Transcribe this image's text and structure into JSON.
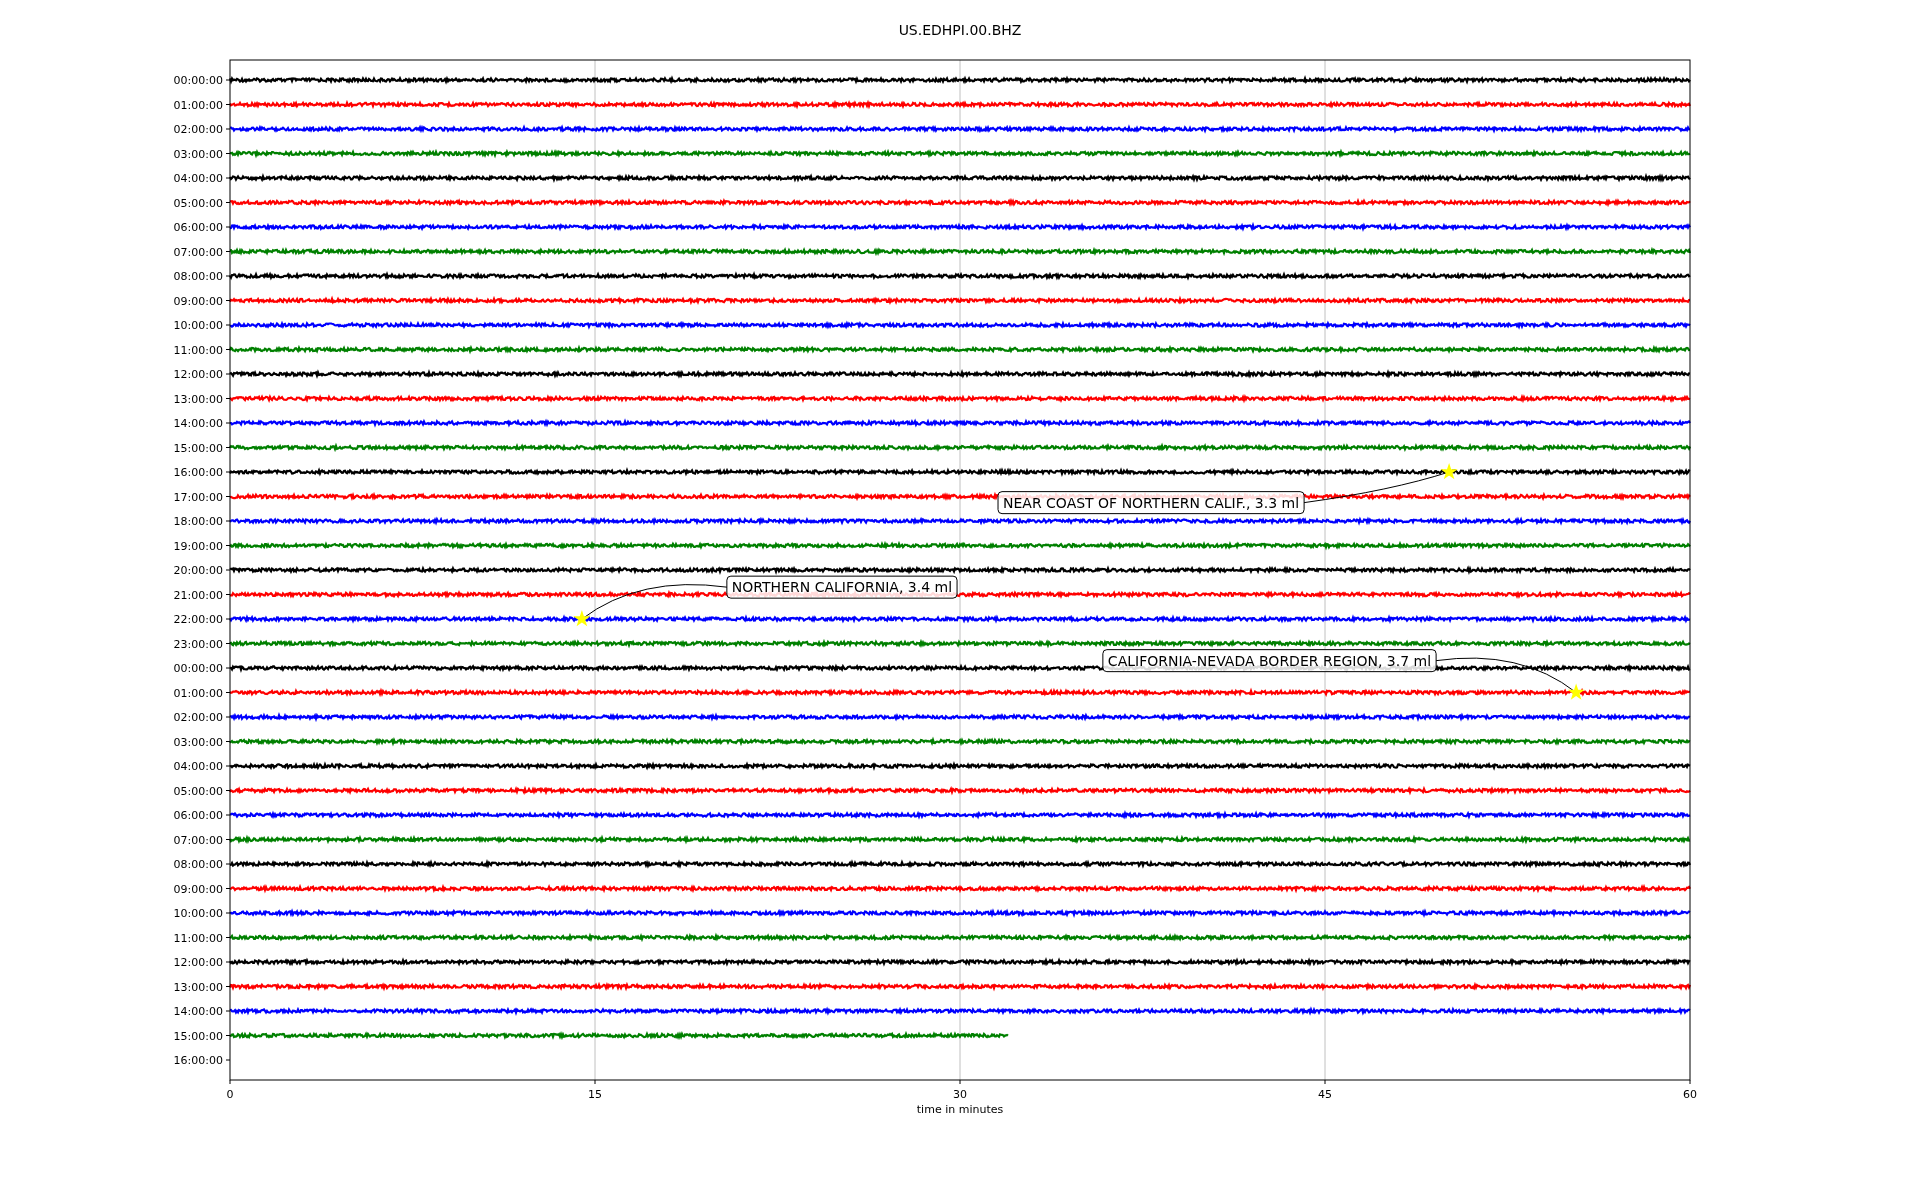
{
  "title": "US.EDHPI.00.BHZ",
  "helicorder": {
    "x_axis": {
      "label": "time in minutes",
      "ticks": [
        "0",
        "15",
        "30",
        "45",
        "60"
      ]
    },
    "rows": [
      {
        "label": "00:00:00",
        "color": "#000000",
        "level": 1
      },
      {
        "label": "01:00:00",
        "color": "#ff0000",
        "level": 1
      },
      {
        "label": "02:00:00",
        "color": "#0000ff",
        "level": 1
      },
      {
        "label": "03:00:00",
        "color": "#008000",
        "level": 1
      },
      {
        "label": "04:00:00",
        "color": "#000000",
        "level": 1
      },
      {
        "label": "05:00:00",
        "color": "#ff0000",
        "level": 1
      },
      {
        "label": "06:00:00",
        "color": "#0000ff",
        "level": 1
      },
      {
        "label": "07:00:00",
        "color": "#008000",
        "level": 1
      },
      {
        "label": "08:00:00",
        "color": "#000000",
        "level": 1
      },
      {
        "label": "09:00:00",
        "color": "#ff0000",
        "level": 1
      },
      {
        "label": "10:00:00",
        "color": "#0000ff",
        "level": 1
      },
      {
        "label": "11:00:00",
        "color": "#008000",
        "level": 1
      },
      {
        "label": "12:00:00",
        "color": "#000000",
        "level": 1
      },
      {
        "label": "13:00:00",
        "color": "#ff0000",
        "level": 1
      },
      {
        "label": "14:00:00",
        "color": "#0000ff",
        "level": 1
      },
      {
        "label": "15:00:00",
        "color": "#008000",
        "level": 1
      },
      {
        "label": "16:00:00",
        "color": "#000000",
        "level": 1,
        "events": [
          {
            "text": "NEAR COAST OF NORTHERN CALIF., 3.3 ml",
            "level": 0.835,
            "label_below": true
          }
        ]
      },
      {
        "label": "17:00:00",
        "color": "#ff0000",
        "level": 1
      },
      {
        "label": "18:00:00",
        "color": "#0000ff",
        "level": 1
      },
      {
        "label": "19:00:00",
        "color": "#008000",
        "level": 1
      },
      {
        "label": "20:00:00",
        "color": "#000000",
        "level": 1
      },
      {
        "label": "21:00:00",
        "color": "#ff0000",
        "level": 1
      },
      {
        "label": "22:00:00",
        "color": "#0000ff",
        "level": 1,
        "events": [
          {
            "text": "NORTHERN CALIFORNIA, 3.4 ml",
            "level": 0.241,
            "label_below": false
          }
        ]
      },
      {
        "label": "23:00:00",
        "color": "#008000",
        "level": 1
      },
      {
        "label": "00:00:00",
        "color": "#000000",
        "level": 1
      },
      {
        "label": "01:00:00",
        "color": "#ff0000",
        "level": 1,
        "events": [
          {
            "text": "CALIFORNIA-NEVADA BORDER REGION, 3.7 ml",
            "level": 0.922,
            "label_below": false
          }
        ]
      },
      {
        "label": "02:00:00",
        "color": "#0000ff",
        "level": 1
      },
      {
        "label": "03:00:00",
        "color": "#008000",
        "level": 1
      },
      {
        "label": "04:00:00",
        "color": "#000000",
        "level": 1
      },
      {
        "label": "05:00:00",
        "color": "#ff0000",
        "level": 1
      },
      {
        "label": "06:00:00",
        "color": "#0000ff",
        "level": 1
      },
      {
        "label": "07:00:00",
        "color": "#008000",
        "level": 1
      },
      {
        "label": "08:00:00",
        "color": "#000000",
        "level": 1
      },
      {
        "label": "09:00:00",
        "color": "#ff0000",
        "level": 1
      },
      {
        "label": "10:00:00",
        "color": "#0000ff",
        "level": 1
      },
      {
        "label": "11:00:00",
        "color": "#008000",
        "level": 1
      },
      {
        "label": "12:00:00",
        "color": "#000000",
        "level": 1
      },
      {
        "label": "13:00:00",
        "color": "#ff0000",
        "level": 1
      },
      {
        "label": "14:00:00",
        "color": "#0000ff",
        "level": 1
      },
      {
        "label": "15:00:00",
        "color": "#008000",
        "level": 0.533
      },
      {
        "label": "16:00:00"
      }
    ]
  }
}
